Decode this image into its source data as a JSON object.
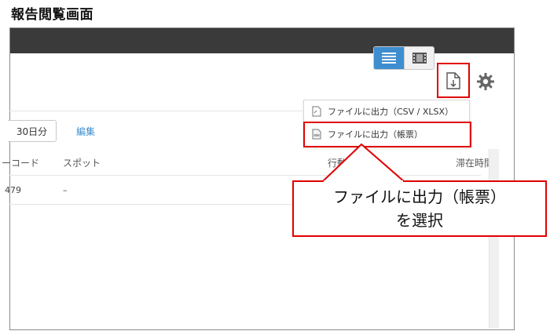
{
  "page_title": "報告閲覧画面",
  "toolbar": {
    "view_list_icon": "list-view-icon",
    "view_grid_icon": "film-view-icon",
    "export_icon": "file-download-icon",
    "settings_icon": "gear-icon"
  },
  "export_menu": {
    "items": [
      {
        "label": "ファイルに出力（CSV / XLSX）",
        "icon": "file-export-icon"
      },
      {
        "label": "ファイルに出力（帳票）",
        "icon": "pdf-file-icon"
      }
    ]
  },
  "period": {
    "days_button": "30日分",
    "edit_link": "編集"
  },
  "table": {
    "headers": [
      "ーコード",
      "スポット",
      "行動",
      "滞在時間"
    ],
    "rows": [
      [
        "479",
        "–"
      ]
    ]
  },
  "callout": {
    "line1": "ファイルに出力（帳票）",
    "line2": "を選択"
  },
  "colors": {
    "accent_blue": "#3d8ed0",
    "highlight_red": "#e00000",
    "titlebar": "#3a3a3a"
  }
}
